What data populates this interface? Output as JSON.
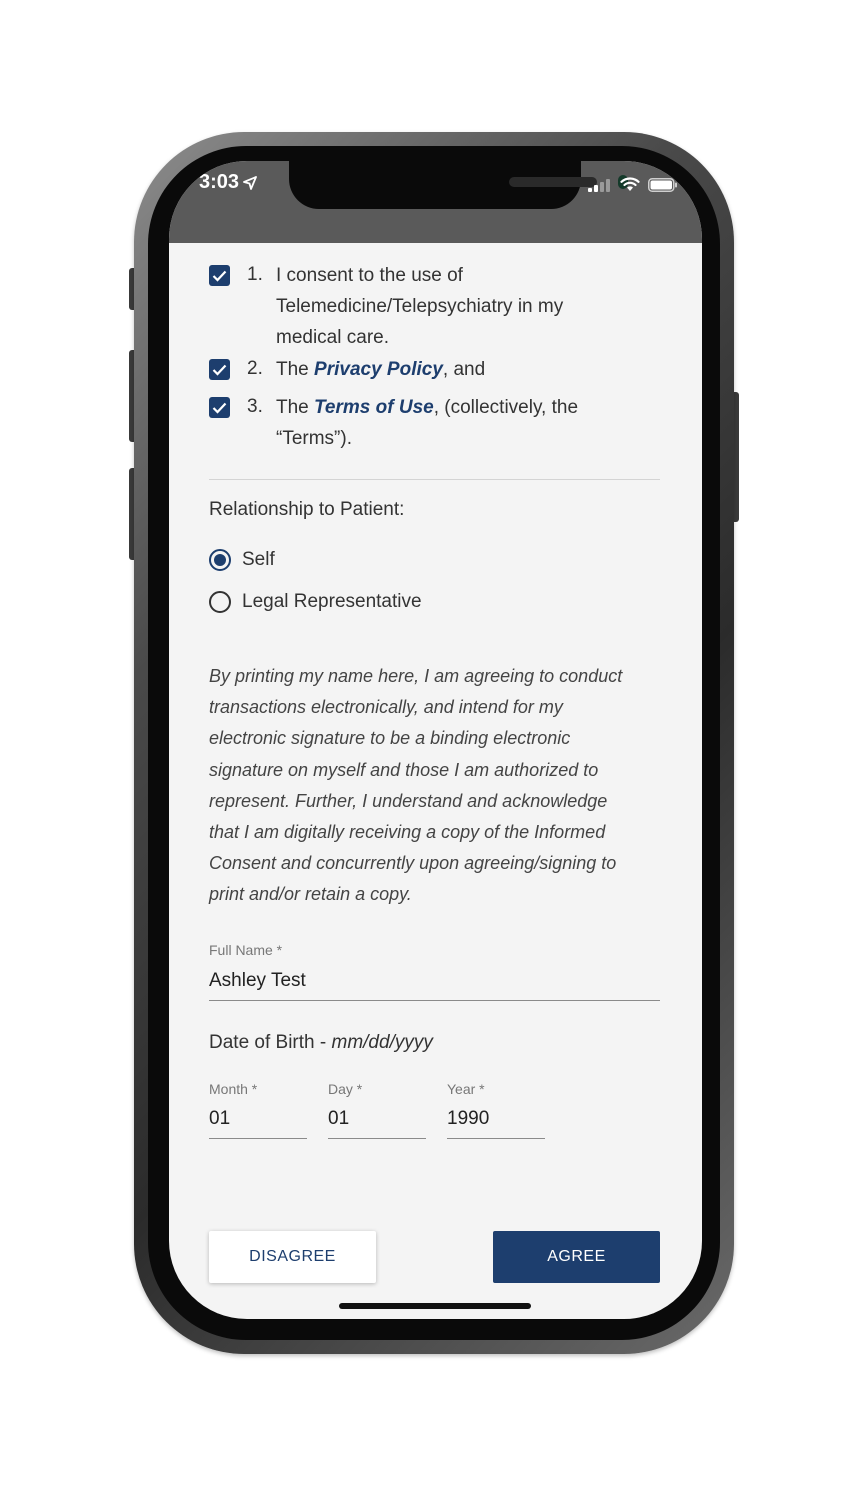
{
  "status_bar": {
    "time": "3:03",
    "location_icon": "location-arrow-icon",
    "signal_icon": "cellular-signal-icon",
    "wifi_icon": "wifi-icon",
    "battery_icon": "battery-icon"
  },
  "consent_items": [
    {
      "number": "1.",
      "checked": true,
      "lines": [
        "I consent to the use of",
        "Telemedicine/Telepsychiatry in my",
        "medical care."
      ]
    },
    {
      "number": "2.",
      "checked": true,
      "prefix": "The ",
      "link": "Privacy Policy",
      "suffix": ", and"
    },
    {
      "number": "3.",
      "checked": true,
      "prefix": "The ",
      "link": "Terms of Use",
      "suffix": ", (collectively, the",
      "line2": "“Terms”)."
    }
  ],
  "relationship": {
    "label": "Relationship to Patient:",
    "options": [
      {
        "label": "Self",
        "selected": true
      },
      {
        "label": "Legal Representative",
        "selected": false
      }
    ]
  },
  "disclaimer_lines": [
    "By printing my name here, I am agreeing to conduct",
    "transactions electronically, and intend for my",
    "electronic signature to be a binding electronic",
    "signature on myself and those I am authorized to",
    "represent. Further, I understand and acknowledge",
    "that I am digitally receiving a copy of the Informed",
    "Consent and concurrently upon agreeing/signing to",
    "print and/or retain a copy."
  ],
  "full_name": {
    "label": "Full Name *",
    "value": "Ashley Test"
  },
  "dob": {
    "title": "Date of Birth - ",
    "format_hint": "mm/dd/yyyy",
    "month": {
      "label": "Month *",
      "value": "01"
    },
    "day": {
      "label": "Day *",
      "value": "01"
    },
    "year": {
      "label": "Year *",
      "value": "1990"
    }
  },
  "buttons": {
    "disagree": "DISAGREE",
    "agree": "AGREE"
  },
  "colors": {
    "primary": "#1d3e6e",
    "status_bar": "#5a5a5a",
    "screen_bg": "#f4f4f4"
  }
}
